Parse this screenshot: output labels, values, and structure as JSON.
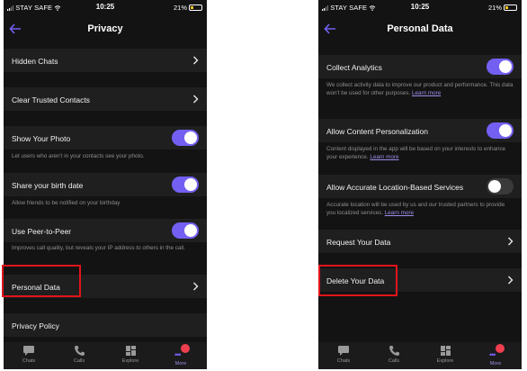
{
  "status_bar": {
    "carrier": "STAY SAFE",
    "time": "10:25",
    "battery": "21%",
    "battery_color": "#f5c518"
  },
  "accent_color": "#7360f2",
  "privacy_screen": {
    "title": "Privacy",
    "rows": {
      "hidden_chats": "Hidden Chats",
      "clear_trusted_contacts": "Clear Trusted Contacts",
      "show_photo": "Show Your Photo",
      "show_photo_desc": "Let users who aren't in your contacts see your photo.",
      "birth_date": "Share your birth date",
      "birth_date_desc": "Allow friends to be notified on your birthday",
      "peer_to_peer": "Use Peer-to-Peer",
      "peer_to_peer_desc": "Improves call quality, but reveals your IP address to others in the call.",
      "personal_data": "Personal Data",
      "privacy_policy": "Privacy Policy"
    },
    "toggles": {
      "show_photo": true,
      "birth_date": true,
      "peer_to_peer": true
    }
  },
  "personal_data_screen": {
    "title": "Personal Data",
    "rows": {
      "collect_analytics": "Collect Analytics",
      "collect_analytics_desc": "We collect activity data to improve our product and performance. This data won't be used for other purposes.",
      "content_personalization": "Allow Content Personalization",
      "content_personalization_desc": "Content displayed in the app will be based on your interests to enhance your experience.",
      "location_services": "Allow Accurate Location-Based Services",
      "location_services_desc": "Accurate location will be used by us and our trusted partners to provide you localized services.",
      "learn_more": "Learn more",
      "request_data": "Request Your Data",
      "delete_data": "Delete Your Data"
    },
    "toggles": {
      "collect_analytics": true,
      "content_personalization": true,
      "location_services": false
    }
  },
  "tab_bar": {
    "chats": "Chats",
    "calls": "Calls",
    "explore": "Explore",
    "more": "More",
    "active": "More",
    "icons": [
      "chat-bubble-icon",
      "phone-icon",
      "explore-grid-icon",
      "more-dots-icon"
    ]
  },
  "highlight_color": "#e2141b"
}
